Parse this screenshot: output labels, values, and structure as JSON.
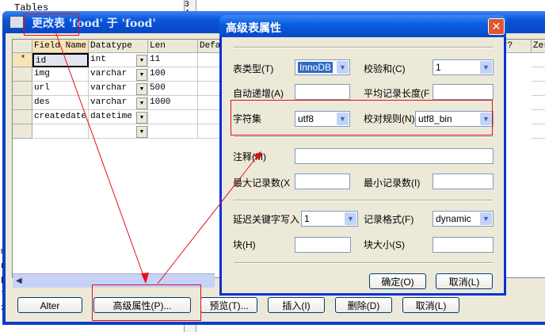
{
  "background": {
    "tree_label": "Tables",
    "line_numbers": [
      "3",
      "4"
    ],
    "edge_letters": [
      "m",
      "n",
      "p",
      "t",
      "x"
    ]
  },
  "window": {
    "title": "更改表 'food' 于 'food'",
    "columns": [
      "Field Name",
      "Datatype",
      "Len",
      "Defa",
      "r?",
      "Zer"
    ],
    "rows": [
      {
        "marker": "*",
        "name": "id",
        "type": "int",
        "len": "11"
      },
      {
        "marker": "",
        "name": "img",
        "type": "varchar",
        "len": "100"
      },
      {
        "marker": "",
        "name": "url",
        "type": "varchar",
        "len": "500"
      },
      {
        "marker": "",
        "name": "des",
        "type": "varchar",
        "len": "1000"
      },
      {
        "marker": "",
        "name": "createdate",
        "type": "datetime",
        "len": ""
      },
      {
        "marker": "",
        "name": "",
        "type": "",
        "len": ""
      }
    ],
    "buttons": {
      "alter": "Alter",
      "advanced": "高级属性(P)...",
      "preview": "预览(T)...",
      "insert": "插入(I)",
      "delete": "删除(D)",
      "cancel": "取消(L)"
    }
  },
  "dialog": {
    "title": "高级表属性",
    "close": "✕",
    "labels": {
      "table_type": "表类型(T)",
      "checksum": "校验和(C)",
      "auto_inc": "自动递增(A)",
      "avg_row": "平均记录长度(F",
      "charset": "字符集",
      "collation": "校对规则(N)",
      "comment": "注释(M)",
      "max_rows": "最大记录数(X",
      "min_rows": "最小记录数(I)",
      "delay_key": "延迟关键字写入",
      "row_format": "记录格式(F)",
      "block": "块(H)",
      "block_size": "块大小(S)"
    },
    "values": {
      "table_type": "InnoDB",
      "checksum": "1",
      "charset": "utf8",
      "collation": "utf8_bin",
      "delay_key": "1",
      "row_format": "dynamic",
      "auto_inc": "",
      "avg_row": "",
      "comment": "",
      "max_rows": "",
      "min_rows": "",
      "block": "",
      "block_size": ""
    },
    "ok": "确定(O)",
    "cancel": "取消(L)"
  },
  "colors": {
    "annotation": "#e0101a",
    "titlebar": "#0a55d9"
  }
}
